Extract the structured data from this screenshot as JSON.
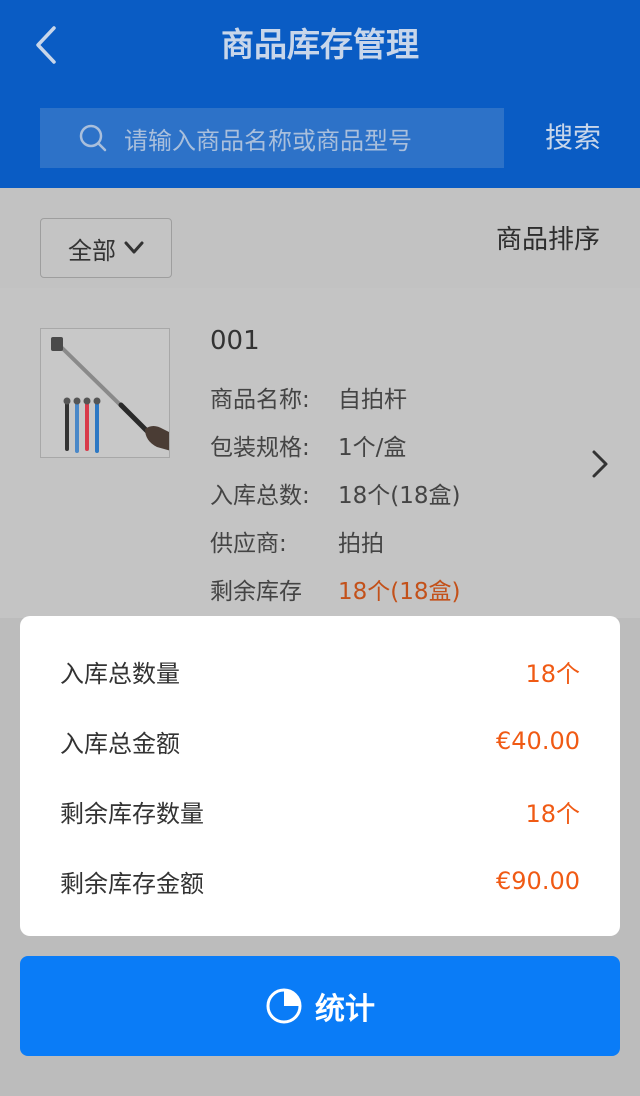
{
  "header": {
    "title": "商品库存管理",
    "search_placeholder": "请输入商品名称或商品型号",
    "search_button": "搜索"
  },
  "filter": {
    "selected": "全部",
    "sort_label": "商品排序"
  },
  "product": {
    "code": "001",
    "rows": [
      {
        "label": "商品名称:",
        "value": "自拍杆"
      },
      {
        "label": "包装规格:",
        "value": "1个/盒"
      },
      {
        "label": "入库总数:",
        "value": "18个(18盒)"
      },
      {
        "label": "供应商:",
        "value": "拍拍"
      },
      {
        "label": "剩余库存",
        "value": "18个(18盒)"
      }
    ]
  },
  "stats": [
    {
      "label": "入库总数量",
      "value": "18个"
    },
    {
      "label": "入库总金额",
      "value": "€40.00"
    },
    {
      "label": "剩余库存数量",
      "value": "18个"
    },
    {
      "label": "剩余库存金额",
      "value": "€90.00"
    }
  ],
  "bottom_button": {
    "label": "统计"
  },
  "colors": {
    "header_bg": "#0a5cc4",
    "accent": "#f05a14",
    "button_bg": "#0a7cf7"
  }
}
